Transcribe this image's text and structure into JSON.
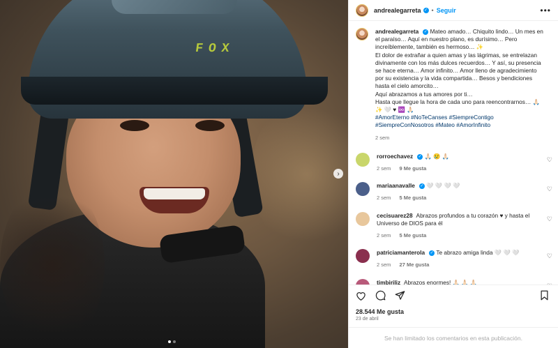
{
  "post": {
    "author": "andrealegarreta",
    "follow_label": "Seguir",
    "separator": "•",
    "more_label": "•••",
    "helmet_brand": "FOX",
    "nav_arrow": "›",
    "caption": {
      "username": "andrealegarreta",
      "lines": [
        "Mateo amado… Chiquito lindo… Un mes en el paraíso… Aquí en nuestro plano, es durísimo… Pero increíblemente, también es hermoso… ✨",
        "El dolor de extrañar a quien amas y las lágrimas, se entrelazan divinamente con los más dulces recuerdos… Y así, su presencia se hace eterna… Amor infinito… Amor lleno de agradecimiento por su existencia y la vida compartida… Besos y bendiciones hasta el cielo amorcito…",
        "Aquí abrazamos a tus amores por ti…",
        "Hasta que llegue la hora de cada uno para reencontrarnos… 🙏🏻",
        "✨ 🤍 ♥ ♾️ 🙏🏻"
      ],
      "hashtags": "#AmorEterno #NoTeCanses #SiempreContigo #SiempreConNosotros #Mateo #AmorInfinito",
      "time": "2 sem"
    },
    "comments": [
      {
        "username": "rorroechavez",
        "text": "🙏🏻 😢 🙏🏻",
        "time": "2 sem",
        "likes": "9 Me gusta",
        "avatar_color": "#c9d66b"
      },
      {
        "username": "mariaanavalle",
        "text": "🤍 🤍 🤍 🤍",
        "time": "2 sem",
        "likes": "5 Me gusta",
        "avatar_color": "#4b5f8a"
      },
      {
        "username": "cecisuarez28",
        "text": "Abrazos profundos a tu corazón ♥ y hasta el Universo de DIOS para él",
        "time": "2 sem",
        "likes": "5 Me gusta",
        "avatar_color": "#e8c79c"
      },
      {
        "username": "patriciamanterola",
        "text": "Te abrazo amiga linda 🤍 🤍 🤍",
        "time": "2 sem",
        "likes": "27 Me gusta",
        "avatar_color": "#8a2f4e"
      },
      {
        "username": "timbiriliz",
        "text": "Abrazos enormes! 🙏🏻 🙏🏻 🙏🏻",
        "time": "",
        "likes": "",
        "avatar_color": "#b85a7a"
      }
    ],
    "total_likes": "28.544 Me gusta",
    "date": "23 de abril",
    "comments_limited": "Se han limitado los comentarios en esta publicación.",
    "carousel": {
      "count": 2,
      "active": 0
    },
    "colors": {
      "accent": "#0095f6",
      "hashtag": "#00376b",
      "muted": "#737373"
    }
  }
}
